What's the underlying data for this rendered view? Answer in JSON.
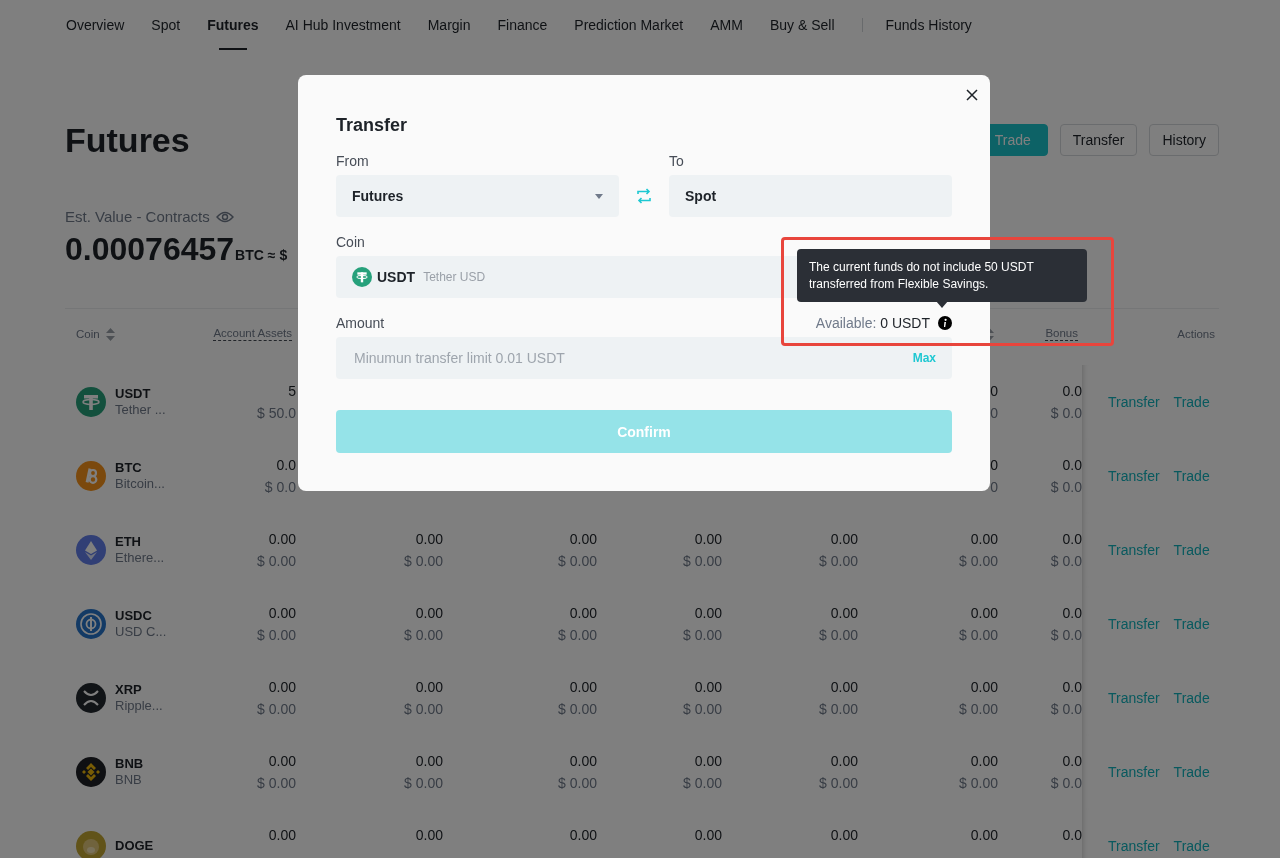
{
  "nav": {
    "tabs": [
      {
        "label": "Overview",
        "selected": false,
        "separated": false
      },
      {
        "label": "Spot",
        "selected": false,
        "separated": false
      },
      {
        "label": "Futures",
        "selected": true,
        "separated": false
      },
      {
        "label": "AI Hub Investment",
        "selected": false,
        "separated": false
      },
      {
        "label": "Margin",
        "selected": false,
        "separated": false
      },
      {
        "label": "Finance",
        "selected": false,
        "separated": false
      },
      {
        "label": "Prediction Market",
        "selected": false,
        "separated": false
      },
      {
        "label": "AMM",
        "selected": false,
        "separated": false
      },
      {
        "label": "Buy & Sell",
        "selected": false,
        "separated": false
      },
      {
        "label": "Funds History",
        "selected": false,
        "separated": true
      }
    ]
  },
  "header": {
    "title": "Futures",
    "buttons": [
      {
        "label": "Trade",
        "kind": "primary"
      },
      {
        "label": "Transfer",
        "kind": "outline"
      },
      {
        "label": "History",
        "kind": "outline"
      }
    ]
  },
  "estimate": {
    "label": "Est. Value - Contracts",
    "value": "0.00076457",
    "unit": "BTC",
    "approx": "≈ $"
  },
  "table": {
    "coin_column": {
      "label": "Coin",
      "sortable": true
    },
    "columns": [
      {
        "label": "Account Assets",
        "underlined": true
      },
      null,
      null,
      null,
      null,
      {
        "sortable": true
      },
      {
        "label": "Bonus",
        "underlined": true
      }
    ],
    "actions_column": {
      "label": "Actions"
    },
    "rows": [
      {
        "symbol": "USDT",
        "name": "Tether ...",
        "cells": [
          {
            "amount": "5",
            "usd": "$ 50.0"
          },
          null,
          null,
          null,
          null,
          {
            "amount": "0",
            "usd": "0"
          },
          {
            "amount": "0.0",
            "usd": "$ 0.0"
          }
        ],
        "actions": [
          "Transfer",
          "Trade"
        ]
      },
      {
        "symbol": "BTC",
        "name": "Bitcoin...",
        "cells": [
          {
            "amount": "0.0",
            "usd": "$ 0.0"
          },
          null,
          null,
          null,
          null,
          {
            "amount": "0",
            "usd": "0"
          },
          {
            "amount": "0.0",
            "usd": "$ 0.0"
          }
        ],
        "actions": [
          "Transfer",
          "Trade"
        ]
      },
      {
        "symbol": "ETH",
        "name": "Ethere...",
        "cells": [
          {
            "amount": "0.00",
            "usd": "$ 0.00"
          },
          {
            "amount": "0.00",
            "usd": "$ 0.00"
          },
          {
            "amount": "0.00",
            "usd": "$ 0.00"
          },
          {
            "amount": "0.00",
            "usd": "$ 0.00"
          },
          {
            "amount": "0.00",
            "usd": "$ 0.00"
          },
          {
            "amount": "0.00",
            "usd": "$ 0.00"
          },
          {
            "amount": "0.0",
            "usd": "$ 0.0"
          }
        ],
        "actions": [
          "Transfer",
          "Trade"
        ]
      },
      {
        "symbol": "USDC",
        "name": "USD C...",
        "cells": [
          {
            "amount": "0.00",
            "usd": "$ 0.00"
          },
          {
            "amount": "0.00",
            "usd": "$ 0.00"
          },
          {
            "amount": "0.00",
            "usd": "$ 0.00"
          },
          {
            "amount": "0.00",
            "usd": "$ 0.00"
          },
          {
            "amount": "0.00",
            "usd": "$ 0.00"
          },
          {
            "amount": "0.00",
            "usd": "$ 0.00"
          },
          {
            "amount": "0.0",
            "usd": "$ 0.0"
          }
        ],
        "actions": [
          "Transfer",
          "Trade"
        ]
      },
      {
        "symbol": "XRP",
        "name": "Ripple...",
        "cells": [
          {
            "amount": "0.00",
            "usd": "$ 0.00"
          },
          {
            "amount": "0.00",
            "usd": "$ 0.00"
          },
          {
            "amount": "0.00",
            "usd": "$ 0.00"
          },
          {
            "amount": "0.00",
            "usd": "$ 0.00"
          },
          {
            "amount": "0.00",
            "usd": "$ 0.00"
          },
          {
            "amount": "0.00",
            "usd": "$ 0.00"
          },
          {
            "amount": "0.0",
            "usd": "$ 0.0"
          }
        ],
        "actions": [
          "Transfer",
          "Trade"
        ]
      },
      {
        "symbol": "BNB",
        "name": "BNB",
        "cells": [
          {
            "amount": "0.00",
            "usd": "$ 0.00"
          },
          {
            "amount": "0.00",
            "usd": "$ 0.00"
          },
          {
            "amount": "0.00",
            "usd": "$ 0.00"
          },
          {
            "amount": "0.00",
            "usd": "$ 0.00"
          },
          {
            "amount": "0.00",
            "usd": "$ 0.00"
          },
          {
            "amount": "0.00",
            "usd": "$ 0.00"
          },
          {
            "amount": "0.0",
            "usd": "$ 0.0"
          }
        ],
        "actions": [
          "Transfer",
          "Trade"
        ]
      },
      {
        "symbol": "DOGE",
        "cells": [
          {
            "amount": "0.00"
          },
          {
            "amount": "0.00"
          },
          {
            "amount": "0.00"
          },
          {
            "amount": "0.00"
          },
          {
            "amount": "0.00"
          },
          {
            "amount": "0.00"
          },
          {
            "amount": "0.0"
          }
        ],
        "actions": [
          "Transfer",
          "Trade"
        ]
      }
    ]
  },
  "modal": {
    "title": "Transfer",
    "from": {
      "label": "From",
      "value": "Futures"
    },
    "to": {
      "label": "To",
      "value": "Spot"
    },
    "coin": {
      "label": "Coin",
      "symbol": "USDT",
      "name": "Tether USD"
    },
    "amount": {
      "label": "Amount",
      "available_label": "Available:",
      "available_value": "0 USDT",
      "placeholder": "Minumun transfer limit 0.01 USDT",
      "max": "Max"
    },
    "confirm": {
      "label": "Confirm",
      "disabled": true
    },
    "tooltip": "The current funds do not include 50 USDT transferred from Flexible Savings."
  }
}
